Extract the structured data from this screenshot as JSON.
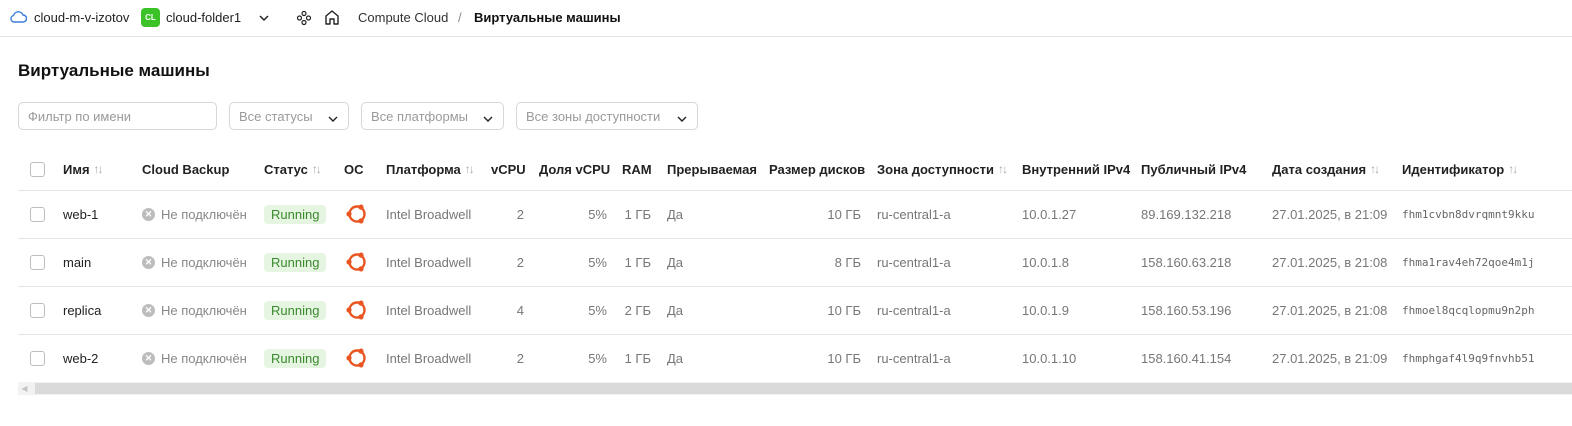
{
  "topbar": {
    "cloud_name": "cloud-m-v-izotov",
    "folder_badge": "CL",
    "folder_name": "cloud-folder1",
    "breadcrumb_service": "Compute Cloud",
    "breadcrumb_sep": "/",
    "breadcrumb_page": "Виртуальные машины"
  },
  "page_title": "Виртуальные машины",
  "filters": {
    "search_placeholder": "Фильтр по имени",
    "status": "Все статусы",
    "platform": "Все платформы",
    "zone": "Все зоны доступности"
  },
  "columns": {
    "name": "Имя",
    "backup": "Cloud Backup",
    "status": "Статус",
    "os": "ОС",
    "platform": "Платформа",
    "vcpu": "vCPU",
    "vcpu_share": "Доля vCPU",
    "ram": "RAM",
    "preemptible": "Прерываемая",
    "disk_size": "Размер дисков",
    "zone": "Зона доступности",
    "internal_ip": "Внутренний IPv4",
    "public_ip": "Публичный IPv4",
    "created": "Дата создания",
    "id": "Идентификатор"
  },
  "rows": [
    {
      "name": "web-1",
      "backup": "Не подключён",
      "status": "Running",
      "os": "ubuntu-icon",
      "platform": "Intel Broadwell",
      "vcpu": "2",
      "vcpu_share": "5%",
      "ram": "1 ГБ",
      "preemptible": "Да",
      "disk_size": "10 ГБ",
      "zone": "ru-central1-a",
      "internal_ip": "10.0.1.27",
      "public_ip": "89.169.132.218",
      "created": "27.01.2025, в 21:09",
      "id": "fhm1cvbn8dvrqmnt9kku"
    },
    {
      "name": "main",
      "backup": "Не подключён",
      "status": "Running",
      "os": "ubuntu-icon",
      "platform": "Intel Broadwell",
      "vcpu": "2",
      "vcpu_share": "5%",
      "ram": "1 ГБ",
      "preemptible": "Да",
      "disk_size": "8 ГБ",
      "zone": "ru-central1-a",
      "internal_ip": "10.0.1.8",
      "public_ip": "158.160.63.218",
      "created": "27.01.2025, в 21:08",
      "id": "fhma1rav4eh72qoe4m1j"
    },
    {
      "name": "replica",
      "backup": "Не подключён",
      "status": "Running",
      "os": "ubuntu-icon",
      "platform": "Intel Broadwell",
      "vcpu": "4",
      "vcpu_share": "5%",
      "ram": "2 ГБ",
      "preemptible": "Да",
      "disk_size": "10 ГБ",
      "zone": "ru-central1-a",
      "internal_ip": "10.0.1.9",
      "public_ip": "158.160.53.196",
      "created": "27.01.2025, в 21:08",
      "id": "fhmoel8qcqlopmu9n2ph"
    },
    {
      "name": "web-2",
      "backup": "Не подключён",
      "status": "Running",
      "os": "ubuntu-icon",
      "platform": "Intel Broadwell",
      "vcpu": "2",
      "vcpu_share": "5%",
      "ram": "1 ГБ",
      "preemptible": "Да",
      "disk_size": "10 ГБ",
      "zone": "ru-central1-a",
      "internal_ip": "10.0.1.10",
      "public_ip": "158.160.41.154",
      "created": "27.01.2025, в 21:09",
      "id": "fhmphgaf4l9q9fnvhb51"
    }
  ],
  "colors": {
    "accent_green": "#3ac227",
    "status_running_bg": "#e6f4e2",
    "status_running_text": "#3a8a2d",
    "ubuntu_orange": "#e95420"
  }
}
